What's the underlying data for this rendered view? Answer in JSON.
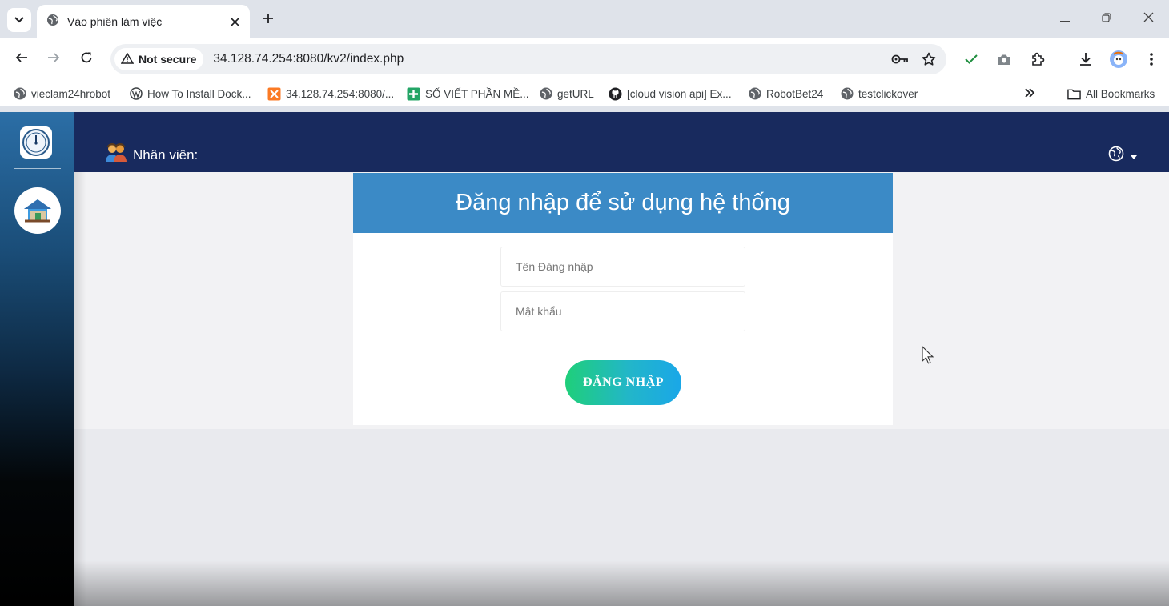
{
  "browser": {
    "tab": {
      "title": "Vào phiên làm việc"
    },
    "security_label": "Not secure",
    "url": "34.128.74.254:8080/kv2/index.php",
    "bookmarks": [
      {
        "label": "vieclam24hrobot",
        "icon": "globe-icon"
      },
      {
        "label": "How To Install Dock...",
        "icon": "wordpress-icon"
      },
      {
        "label": "34.128.74.254:8080/...",
        "icon": "xampp-icon"
      },
      {
        "label": "SỐ VIẾT PHẦN MỀ...",
        "icon": "sheets-icon"
      },
      {
        "label": "getURL",
        "icon": "globe-icon"
      },
      {
        "label": "[cloud vision api] Ex...",
        "icon": "github-icon"
      },
      {
        "label": "RobotBet24",
        "icon": "globe-icon"
      },
      {
        "label": "testclickover",
        "icon": "globe-icon"
      }
    ],
    "all_bookmarks_label": "All Bookmarks"
  },
  "app": {
    "header": {
      "staff_label": "Nhân viên:"
    },
    "login": {
      "title": "Đăng nhập để sử dụng hệ thống",
      "username_placeholder": "Tên Đăng nhập",
      "password_placeholder": "Mật khẩu",
      "submit_label": "ĐĂNG NHẬP"
    }
  },
  "colors": {
    "nav_bg": "#182a5e",
    "login_header": "#3b8ac6",
    "button_gradient_start": "#1fcf7a",
    "button_gradient_end": "#1aa7e8"
  }
}
